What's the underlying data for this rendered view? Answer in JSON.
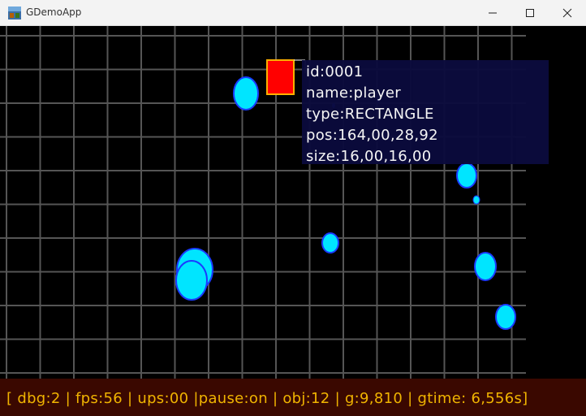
{
  "window": {
    "title": "GDemoApp",
    "minimize_icon": "minimize-icon",
    "maximize_icon": "maximize-icon",
    "close_icon": "close-icon"
  },
  "scene": {
    "background": "#000000",
    "grid_color": "#555555",
    "ball_color": "#00e5ff",
    "ball_outline": "#1a3cff",
    "player_fill": "#ff0000",
    "player_outline": "#ffb000"
  },
  "tooltip": {
    "id": "id:0001",
    "name": "name:player",
    "type": "type:RECTANGLE",
    "pos": "pos:164,00,28,92",
    "size": "size:16,00,16,00"
  },
  "status": {
    "text": "[ dbg:2 | fps:56 | ups:00 |pause:on | obj:12 | g:9,810 | gtime: 6,556s]"
  }
}
